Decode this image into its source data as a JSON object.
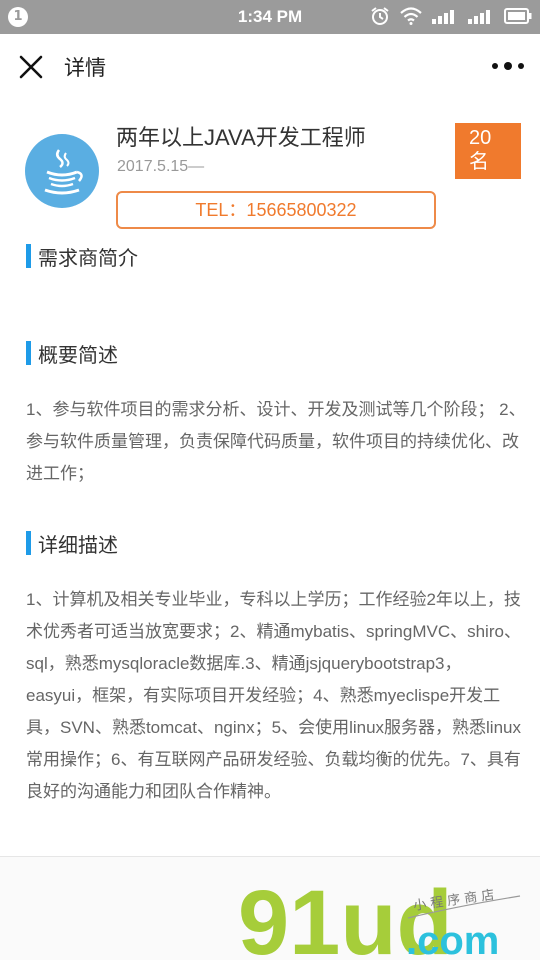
{
  "status_bar": {
    "notification_badge": "1",
    "time": "1:34 PM",
    "icons": [
      "alarm-icon",
      "wifi-icon",
      "signal-icon",
      "signal-icon",
      "battery-icon"
    ]
  },
  "nav": {
    "title": "详情",
    "close_icon": "close-icon",
    "more_icon": "more-icon"
  },
  "job": {
    "title": "两年以上JAVA开发工程师",
    "date": "2017.5.15—",
    "count_line1": "20",
    "count_line2": "名",
    "tel": "TEL：15665800322",
    "logo_icon": "java-cup-icon"
  },
  "sections": {
    "intro": {
      "heading": "需求商简介"
    },
    "summary": {
      "heading": "概要简述",
      "text": " 1、参与软件项目的需求分析、设计、开发及测试等几个阶段； 2、参与软件质量管理，负责保障代码质量，软件项目的持续优化、改进工作；"
    },
    "detail": {
      "heading": "详细描述",
      "text": " 1、计算机及相关专业毕业，专科以上学历；工作经验2年以上，技术优秀者可适当放宽要求；2、精通mybatis、springMVC、shiro、sql，熟悉mysqloracle数据库.3、精通jsjquerybootstrap3，easyui，框架，有实际项目开发经验；4、熟悉myeclispe开发工具，SVN、熟悉tomcat、nginx；5、会使用linux服务器，熟悉linux常用操作；6、有互联网产品研发经验、负载均衡的优先。7、具有良好的沟通能力和团队合作精神。"
    }
  },
  "watermark": {
    "brand": "91ud",
    "domain": ".com",
    "tagline": "小程序商店",
    "colors": {
      "green": "#a6cd3a",
      "cyan": "#2cc1dd"
    }
  },
  "colors": {
    "accent_blue": "#1e9be8",
    "accent_orange": "#f07a2d",
    "statusbar": "#9b9b9b",
    "logo_bg": "#5aaee2"
  }
}
